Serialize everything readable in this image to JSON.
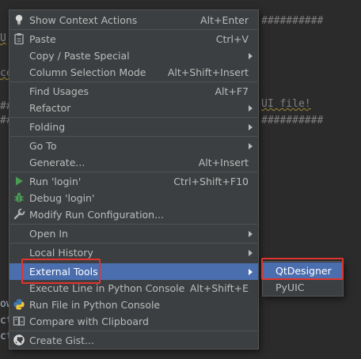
{
  "editor": {
    "line_top_right": "##########",
    "line_u": "U",
    "line_ce": "ce",
    "line_ui_file": "UI file!",
    "line_hash2": "##########",
    "line_hash_left": "##",
    "line_hash_left2": "##",
    "frag_ow": "ow",
    "frag_ct1": "ct",
    "frag_ct2": "ct"
  },
  "menu": {
    "items": [
      {
        "label": "Show Context Actions",
        "shortcut": "Alt+Enter",
        "icon": "lightbulb-icon"
      },
      {
        "label": "Paste",
        "shortcut": "Ctrl+V",
        "icon": "clipboard-icon"
      },
      {
        "label": "Copy / Paste Special",
        "submenu": true
      },
      {
        "label": "Column Selection Mode",
        "shortcut": "Alt+Shift+Insert"
      },
      {
        "label": "Find Usages",
        "shortcut": "Alt+F7"
      },
      {
        "label": "Refactor",
        "submenu": true
      },
      {
        "label": "Folding",
        "submenu": true
      },
      {
        "label": "Go To",
        "submenu": true
      },
      {
        "label": "Generate...",
        "shortcut": "Alt+Insert"
      },
      {
        "label": "Run 'login'",
        "shortcut": "Ctrl+Shift+F10",
        "icon": "run-icon"
      },
      {
        "label": "Debug 'login'",
        "icon": "debug-icon"
      },
      {
        "label": "Modify Run Configuration...",
        "icon": "wrench-icon"
      },
      {
        "label": "Open In",
        "submenu": true
      },
      {
        "label": "Local History",
        "submenu": true
      },
      {
        "label": "External Tools",
        "submenu": true,
        "selected": true
      },
      {
        "label": "Execute Line in Python Console",
        "shortcut": "Alt+Shift+E"
      },
      {
        "label": "Run File in Python Console",
        "icon": "python-icon"
      },
      {
        "label": "Compare with Clipboard",
        "icon": "compare-icon"
      },
      {
        "label": "Create Gist...",
        "icon": "github-icon"
      }
    ]
  },
  "submenu": {
    "items": [
      {
        "label": "QtDesigner",
        "selected": true
      },
      {
        "label": "PyUIC"
      }
    ]
  },
  "colors": {
    "menu_bg": "#3c3f41",
    "selection": "#4b6eaf",
    "annotation_red": "#e0342e",
    "editor_bg": "#2b2b2b"
  }
}
